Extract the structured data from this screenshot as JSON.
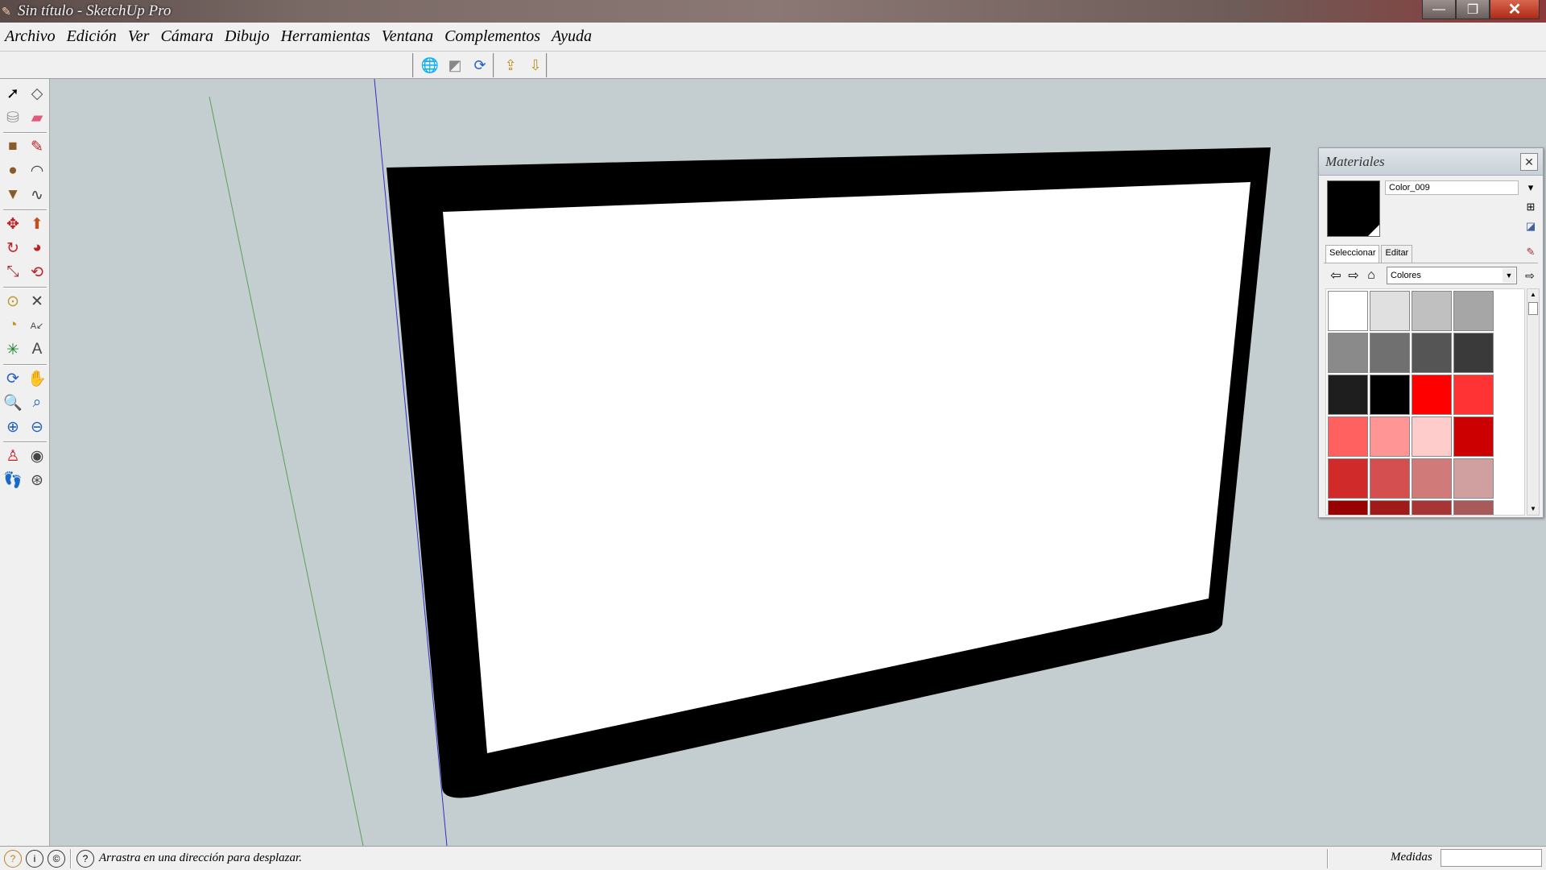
{
  "window": {
    "title": "Sin título - SketchUp Pro",
    "minimize": "—",
    "maximize": "❐",
    "close": "✕"
  },
  "menu": [
    "Archivo",
    "Edición",
    "Ver",
    "Cámara",
    "Dibujo",
    "Herramientas",
    "Ventana",
    "Complementos",
    "Ayuda"
  ],
  "toolbar": {
    "icons": [
      "globe-icon",
      "model-icon",
      "share-icon",
      "upload-component-icon",
      "download-component-icon"
    ]
  },
  "left_tools": [
    "select",
    "component",
    "paint-bucket",
    "eraser",
    "rectangle",
    "line",
    "circle",
    "arc",
    "polygon",
    "freehand",
    "move",
    "push-pull",
    "rotate",
    "follow-me",
    "scale",
    "offset",
    "tape-measure",
    "dimension",
    "protractor",
    "text",
    "axes",
    "3d-text",
    "orbit",
    "pan",
    "zoom",
    "zoom-window",
    "zoom-extents",
    "previous-view",
    "position-camera",
    "look-around",
    "walk",
    "section-plane"
  ],
  "materials": {
    "title": "Materiales",
    "close": "✕",
    "current_name": "Color_009",
    "current_color": "#000000",
    "tabs": [
      "Seleccionar",
      "Editar"
    ],
    "library": "Colores",
    "swatches": [
      "#ffffff",
      "#e0e0e0",
      "#c0c0c0",
      "#a6a6a6",
      "#8a8a8a",
      "#707070",
      "#555555",
      "#3a3a3a",
      "#1e1e1e",
      "#000000",
      "#ff0000",
      "#ff3333",
      "#ff6060",
      "#ff9595",
      "#ffcccc",
      "#cc0000",
      "#d02a2a",
      "#d45050",
      "#d07a7a",
      "#d0a0a0",
      "#990000",
      "#a01a1a",
      "#a83535",
      "#a85a5a"
    ]
  },
  "statusbar": {
    "message": "Arrastra en una dirección para desplazar.",
    "measure_label": "Medidas",
    "measure_value": ""
  }
}
